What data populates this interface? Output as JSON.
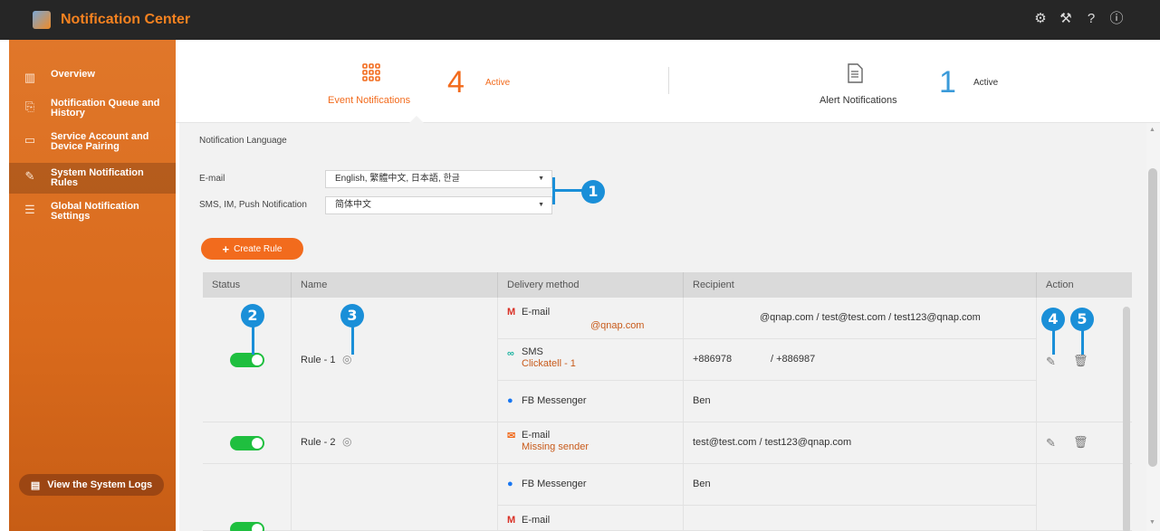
{
  "app": {
    "title": "Notification Center"
  },
  "top_icons": [
    "gear-icon",
    "tools-icon",
    "help-icon",
    "info-icon"
  ],
  "sidebar": {
    "items": [
      {
        "label": "Overview",
        "icon": "chart-icon"
      },
      {
        "label": "Notification Queue and History",
        "icon": "history-icon"
      },
      {
        "label": "Service Account and Device Pairing",
        "icon": "device-icon"
      },
      {
        "label": "System Notification Rules",
        "icon": "rules-icon"
      },
      {
        "label": "Global Notification Settings",
        "icon": "settings-icon"
      }
    ],
    "logs_button": "View the System Logs"
  },
  "tabs": [
    {
      "label": "Event Notifications",
      "count": "4",
      "status": "Active"
    },
    {
      "label": "Alert Notifications",
      "count": "1",
      "status": "Active"
    }
  ],
  "language": {
    "section_title": "Notification Language",
    "email_label": "E-mail",
    "email_value": "English, 繁體中文, 日本語, 한글",
    "sms_label": "SMS, IM, Push Notification",
    "sms_value": "简体中文"
  },
  "callouts": [
    "1",
    "2",
    "3",
    "4",
    "5"
  ],
  "create_button": "Create Rule",
  "table": {
    "headers": [
      "Status",
      "Name",
      "Delivery method",
      "Recipient",
      "Action"
    ],
    "rule1": {
      "name": "Rule - 1",
      "email": {
        "method": "E-mail",
        "sub": "@qnap.com",
        "recipient": "@qnap.com / test@test.com / test123@qnap.com"
      },
      "sms": {
        "method": "SMS",
        "sub": "Clickatell - 1",
        "recipient_a": "+886978",
        "recipient_b": "/ +886987"
      },
      "fb": {
        "method": "FB Messenger",
        "recipient": "Ben"
      }
    },
    "rule2": {
      "name": "Rule - 2",
      "email": {
        "method": "E-mail",
        "sub": "Missing sender",
        "recipient": "test@test.com / test123@qnap.com"
      }
    },
    "rule3": {
      "fb": {
        "method": "FB Messenger",
        "recipient": "Ben"
      },
      "email": {
        "method": "E-mail"
      }
    }
  }
}
